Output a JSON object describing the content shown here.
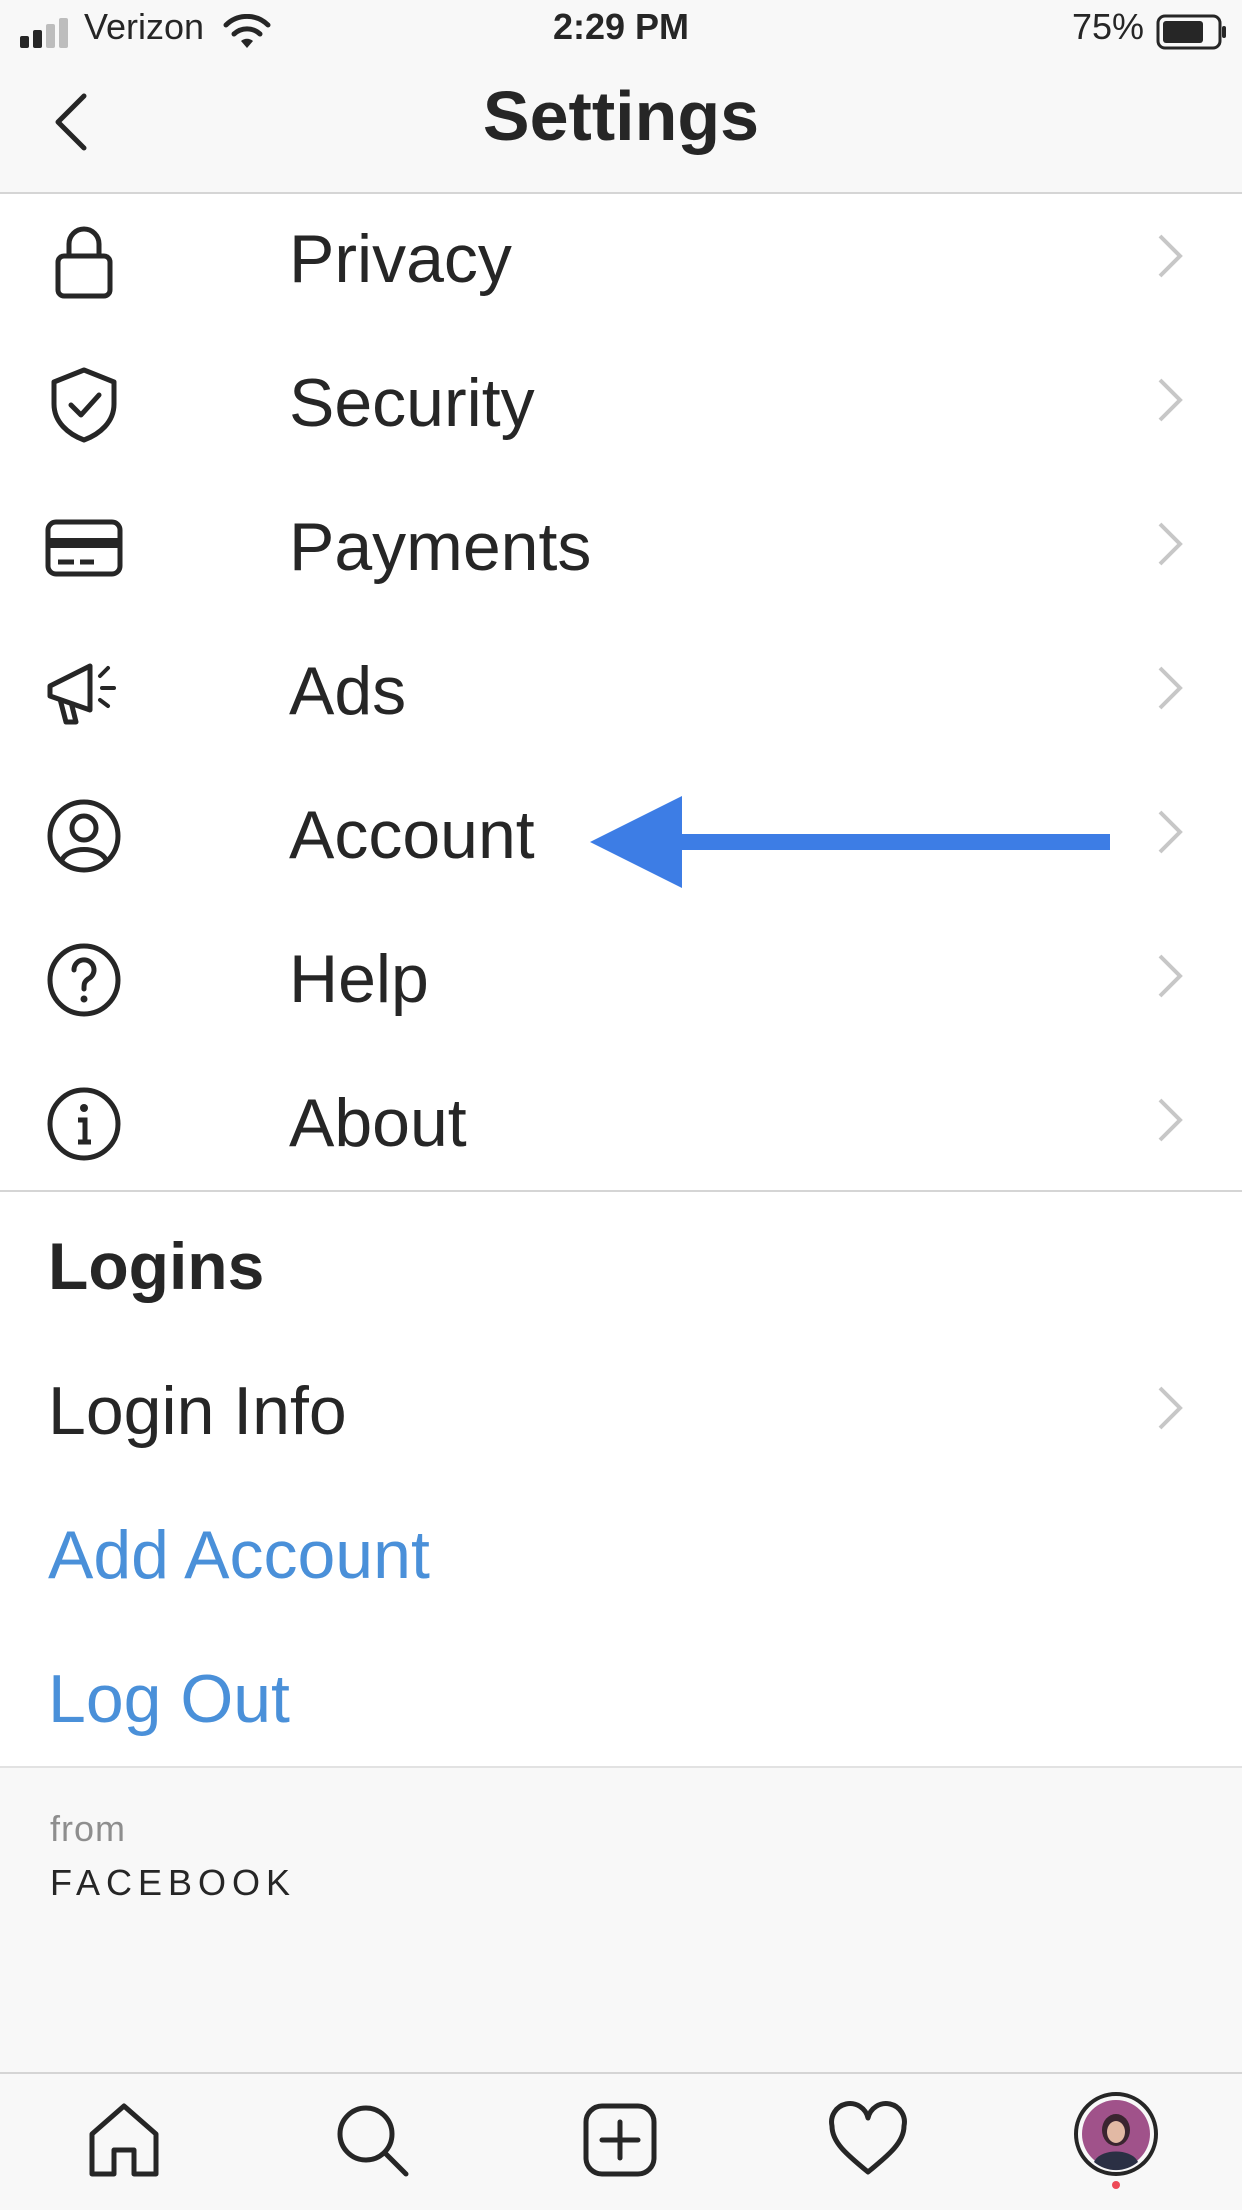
{
  "status_bar": {
    "carrier": "Verizon",
    "time": "2:29 PM",
    "battery": "75%"
  },
  "header": {
    "title": "Settings"
  },
  "rows": [
    {
      "label": "Privacy",
      "icon": "lock-icon"
    },
    {
      "label": "Security",
      "icon": "shield-check-icon"
    },
    {
      "label": "Payments",
      "icon": "credit-card-icon"
    },
    {
      "label": "Ads",
      "icon": "megaphone-icon"
    },
    {
      "label": "Account",
      "icon": "user-circle-icon"
    },
    {
      "label": "Help",
      "icon": "help-circle-icon"
    },
    {
      "label": "About",
      "icon": "info-circle-icon"
    }
  ],
  "logins": {
    "section_title": "Logins",
    "login_info": "Login Info",
    "add_account": "Add Account",
    "log_out": "Log Out"
  },
  "footer": {
    "from": "from",
    "brand": "FACEBOOK"
  },
  "colors": {
    "accent_link": "#4a90d9",
    "annotation_arrow": "#3d7de5"
  },
  "tab_bar": [
    "home-icon",
    "search-icon",
    "add-post-icon",
    "heart-icon",
    "profile-avatar"
  ]
}
